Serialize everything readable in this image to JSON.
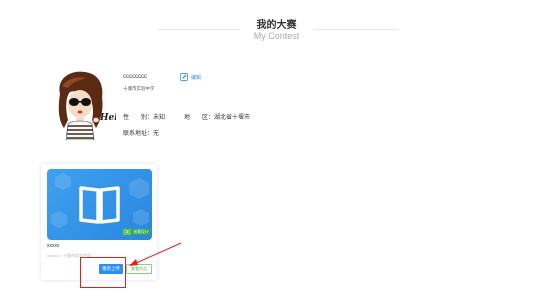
{
  "header": {
    "title_cn": "我的大赛",
    "title_en": "My Contest"
  },
  "profile": {
    "name": "cccccccc",
    "school": "十堰市实验中学",
    "edit_label": "编辑",
    "gender_label": "性　　别：",
    "gender_value": "未知",
    "region_label": "地　　区：",
    "region_value": "湖北省十堰市",
    "address_label": "联系地址：",
    "address_value": "无",
    "avatar_text": "Hello"
  },
  "contest_card": {
    "name": "xxxxx",
    "subtitle": "xxxxxx丨十堰市实验中学",
    "badge_number": "3",
    "badge_category": "创意设计",
    "upload_button": "重新上传",
    "view_button": "查看作品"
  },
  "colors": {
    "primary": "#2b8ef0",
    "success": "#55b845",
    "annotation": "#e02020"
  }
}
